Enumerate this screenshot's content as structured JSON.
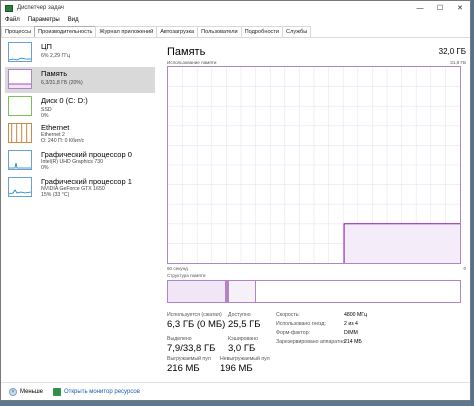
{
  "window": {
    "title": "Диспетчер задач",
    "controls": [
      "—",
      "☐",
      "✕"
    ]
  },
  "menu": [
    "Файл",
    "Параметры",
    "Вид"
  ],
  "tabs": [
    "Процессы",
    "Производительность",
    "Журнал приложений",
    "Автозагрузка",
    "Пользователи",
    "Подробности",
    "Службы"
  ],
  "active_tab": "Производительность",
  "sidebar": {
    "items": [
      {
        "title": "ЦП",
        "sub": [
          "6% 2,29 ГГц"
        ],
        "color": "#117dbb",
        "selected": false
      },
      {
        "title": "Память",
        "sub": [
          "6,3/31,8 ГБ (20%)"
        ],
        "color": "#8b12ae",
        "selected": true
      },
      {
        "title": "Диск 0 (C: D:)",
        "sub": [
          "SSD",
          "0%"
        ],
        "color": "#4da60c",
        "selected": false
      },
      {
        "title": "Ethernet",
        "sub": [
          "Ethernet 2",
          "О: 240 П: 0 Кбит/с"
        ],
        "color": "#a74f01",
        "selected": false
      },
      {
        "title": "Графический процессор 0",
        "sub": [
          "Intel(R) UHD Graphics 730",
          "0%"
        ],
        "color": "#117dbb",
        "selected": false
      },
      {
        "title": "Графический процессор 1",
        "sub": [
          "NVIDIA GeForce GTX 1650",
          "15% (33 °C)"
        ],
        "color": "#117dbb",
        "selected": false
      }
    ]
  },
  "main": {
    "title": "Память",
    "total": "32,0 ГБ",
    "usage_label": "Использование памяти",
    "usage_max": "31,8 ГБ",
    "axis_left": "60 секунд",
    "axis_right": "0",
    "structure_label": "Структура памяти",
    "usage_fraction": 0.2,
    "history": [
      0,
      0,
      0,
      0,
      0,
      0,
      0,
      0,
      0,
      0,
      0,
      0,
      0,
      0,
      0,
      0,
      0,
      0,
      0,
      0,
      0,
      0,
      0,
      0,
      0,
      0,
      0,
      0,
      0,
      0,
      0,
      0,
      0,
      0,
      0,
      0,
      0,
      0,
      0,
      0,
      0,
      0,
      0,
      0,
      0,
      0,
      0,
      0,
      0,
      0,
      0,
      0,
      0,
      0,
      0,
      0,
      0,
      0,
      0,
      0,
      0,
      0,
      0,
      0,
      0,
      0,
      0,
      0,
      0,
      0,
      0,
      0,
      0,
      0,
      0,
      0,
      0,
      0,
      0,
      0,
      0,
      0,
      0,
      0,
      0,
      0,
      0,
      0,
      0,
      0,
      0,
      0,
      0,
      0,
      0,
      0,
      0,
      0,
      0,
      0,
      0,
      0,
      0,
      0,
      0,
      0,
      0,
      0,
      0,
      0,
      0,
      0,
      0,
      0,
      0,
      0,
      0,
      0,
      0,
      0,
      0.2,
      0.2,
      0.2,
      0.2,
      0.2,
      0.2,
      0.2,
      0.2,
      0.2,
      0.2,
      0.2,
      0.2,
      0.2,
      0.2,
      0.2,
      0.2,
      0.2,
      0.2,
      0.2,
      0.2,
      0.2,
      0.2,
      0.2,
      0.2,
      0.2,
      0.2,
      0.2,
      0.2,
      0.2,
      0.2,
      0.2,
      0.2,
      0.2,
      0.2,
      0.2,
      0.2,
      0.2,
      0.2,
      0.2,
      0.2,
      0.2,
      0.2,
      0.2,
      0.2,
      0.2,
      0.2,
      0.2,
      0.2,
      0.2,
      0.2,
      0.2,
      0.2,
      0.2,
      0.2,
      0.2,
      0.2,
      0.2,
      0.2,
      0.2,
      0.2,
      0.2,
      0.2,
      0.2,
      0.2,
      0.2,
      0.2,
      0.2,
      0.2,
      0.2,
      0.2,
      0.2,
      0.2,
      0.2,
      0.2,
      0.2,
      0.2,
      0.2,
      0.2,
      0.2,
      0.2
    ],
    "structure": [
      {
        "name": "in_use",
        "fraction": 0.2,
        "color": "#f1e6f6"
      },
      {
        "name": "modified",
        "fraction": 0.01,
        "color": "#b084c9"
      },
      {
        "name": "standby",
        "fraction": 0.09,
        "color": "#f6f0f9"
      },
      {
        "name": "free",
        "fraction": 0.7,
        "color": "#ffffff"
      }
    ],
    "stats": [
      {
        "label": "Используется (сжатая)",
        "value": "6,3 ГБ (0 МБ)"
      },
      {
        "label": "Доступно",
        "value": "25,5 ГБ"
      },
      {
        "label": "Выделено",
        "value": "7,9/33,8 ГБ"
      },
      {
        "label": "Кэшировано",
        "value": "3,0 ГБ"
      },
      {
        "label": "Выгружаемый пул",
        "value": "216 МБ"
      },
      {
        "label": "Невыгружаемый пул",
        "value": "196 МБ"
      }
    ],
    "info": [
      {
        "label": "Скорость:",
        "value": "4800 МГц"
      },
      {
        "label": "Использовано гнезд:",
        "value": "2 из 4"
      },
      {
        "label": "Форм-фактор:",
        "value": "DIMM"
      },
      {
        "label": "Зарезервировано аппаратно:",
        "value": "214 МБ"
      }
    ]
  },
  "footer": {
    "less": "Меньше",
    "resource_monitor": "Открыть монитор ресурсов"
  }
}
